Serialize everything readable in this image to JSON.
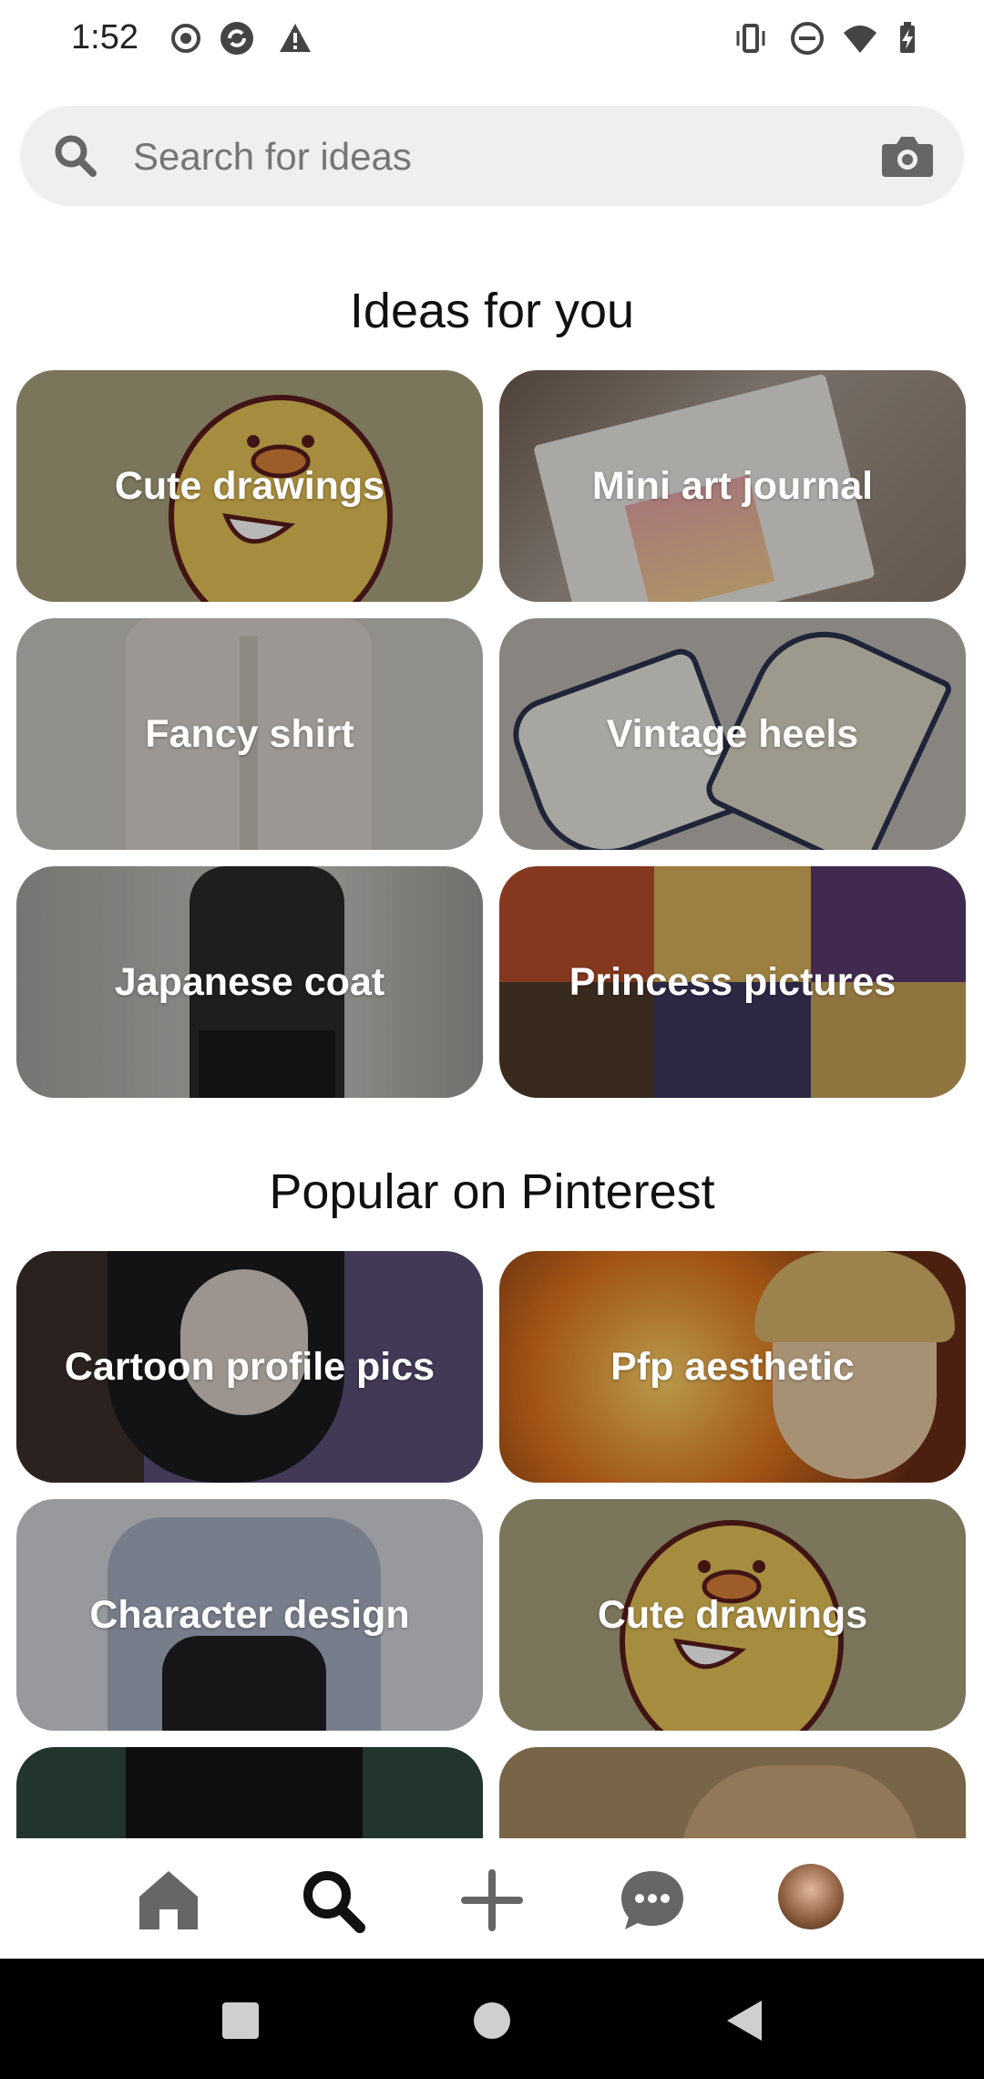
{
  "status_bar": {
    "time": "1:52",
    "left_icons": [
      "record-icon",
      "sync-icon",
      "warning-icon"
    ],
    "right_icons": [
      "vibrate-icon",
      "do-not-disturb-icon",
      "wifi-icon",
      "battery-charging-icon"
    ]
  },
  "search": {
    "placeholder": "Search for ideas",
    "left_icon": "search-icon",
    "right_icon": "camera-icon"
  },
  "sections": {
    "ideas": {
      "title": "Ideas for you",
      "tiles": [
        {
          "label": "Cute drawings",
          "bg": "#a9a37f"
        },
        {
          "label": "Mini art journal",
          "bg": "#8f857c"
        },
        {
          "label": "Fancy shirt",
          "bg": "#c7c4c1"
        },
        {
          "label": "Vintage heels",
          "bg": "#b7b4ae"
        },
        {
          "label": "Japanese coat",
          "bg": "#a7a7a3"
        },
        {
          "label": "Princess pictures",
          "bg": "#7a5a67"
        }
      ]
    },
    "popular": {
      "title": "Popular on Pinterest",
      "tiles": [
        {
          "label": "Cartoon profile pics",
          "bg": "#4b435c"
        },
        {
          "label": "Pfp aesthetic",
          "bg": "#9a4d2c"
        },
        {
          "label": "Character design",
          "bg": "#c8c9cf"
        },
        {
          "label": "Cute drawings",
          "bg": "#a9a37f"
        },
        {
          "label": "",
          "bg": "#2f4a3e"
        },
        {
          "label": "",
          "bg": "#a78b62"
        }
      ]
    }
  },
  "bottom_nav": {
    "items": [
      "home-icon",
      "search-icon",
      "create-icon",
      "messages-icon",
      "profile-avatar"
    ],
    "active": "search-icon"
  },
  "system_nav": {
    "items": [
      "recents-button",
      "home-button",
      "back-button"
    ]
  },
  "colors": {
    "search_bg": "#efefef",
    "text_primary": "#111111",
    "placeholder": "#757575",
    "icon_gray": "#666666",
    "system_nav_bg": "#000000"
  }
}
